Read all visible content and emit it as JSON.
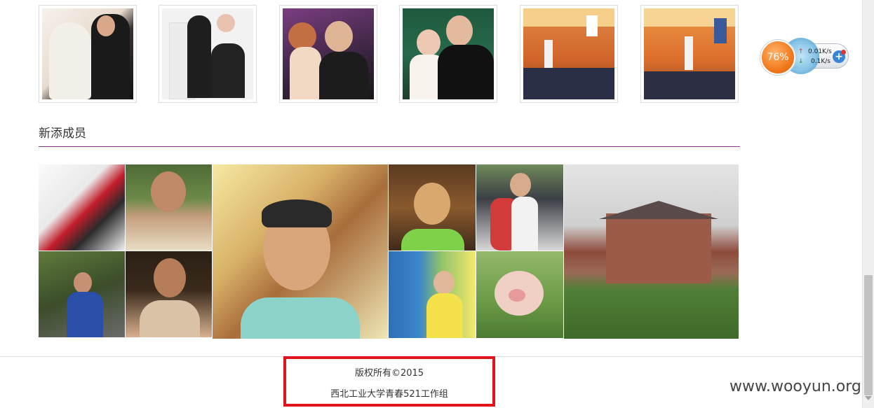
{
  "top_photos": [
    {
      "alt": "wedding-photo-1",
      "colors": [
        "#f4efe9",
        "#d9c8b8",
        "#1d1d1d"
      ]
    },
    {
      "alt": "wedding-photo-2",
      "colors": [
        "#f6f6f6",
        "#e9e9e9",
        "#202020"
      ]
    },
    {
      "alt": "event-photo-1",
      "colors": [
        "#6a3a7a",
        "#2a1f2a",
        "#e3b89e"
      ]
    },
    {
      "alt": "couple-photo",
      "colors": [
        "#1d4a34",
        "#f3efe8",
        "#151515"
      ]
    },
    {
      "alt": "stage-event-1",
      "colors": [
        "#d86b2a",
        "#f2b25a",
        "#2a2f4a"
      ]
    },
    {
      "alt": "stage-event-2",
      "colors": [
        "#e9863a",
        "#f6c26a",
        "#2a2d44"
      ]
    }
  ],
  "new_members": {
    "title": "新添成员"
  },
  "footer": {
    "copyright": "版权所有©2015",
    "organization": "西北工业大学青春521工作组"
  },
  "watermark": "www.wooyun.org",
  "network_widget": {
    "percent": "76%",
    "upload": "0.01K/s",
    "download": "0.1K/s",
    "up_arrow": "↑",
    "down_arrow": "↓",
    "plus": "+"
  }
}
